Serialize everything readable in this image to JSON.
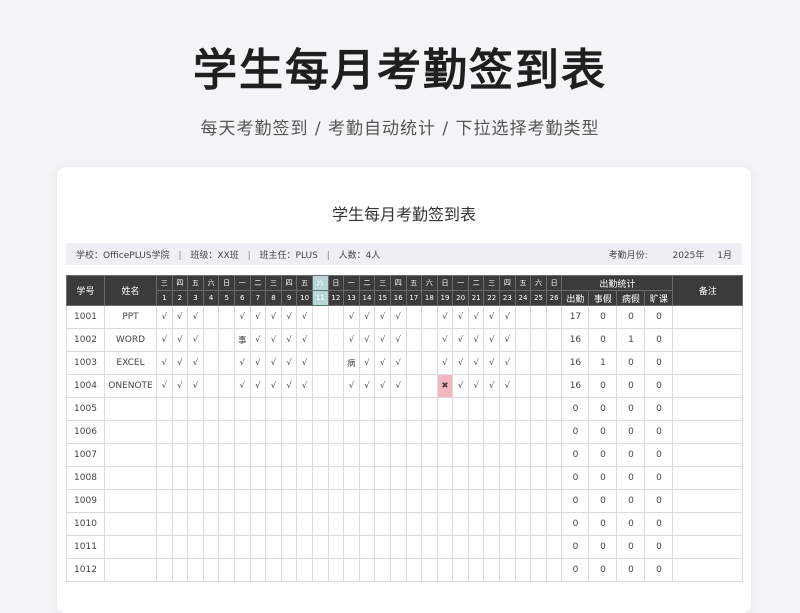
{
  "hero": {
    "title": "学生每月考勤签到表",
    "subtitle": "每天考勤签到 / 考勤自动统计 / 下拉选择考勤类型"
  },
  "sheet": {
    "title": "学生每月考勤签到表",
    "school": "学校：OfficePLUS学院",
    "class_name": "班级：XX班",
    "teacher": "班主任：PLUS",
    "count": "人数：4人",
    "month_label": "考勤月份:",
    "year": "2025年",
    "month": "1月",
    "sep": "|"
  },
  "columns": {
    "id": "学号",
    "name": "姓名",
    "stats_group": "出勤统计",
    "stats": [
      "出勤",
      "事假",
      "病假",
      "旷课"
    ],
    "remark": "备注"
  },
  "weekdays": [
    "三",
    "四",
    "五",
    "六",
    "日",
    "一",
    "二",
    "三",
    "四",
    "五",
    "六",
    "日",
    "一",
    "二",
    "三",
    "四",
    "五",
    "六",
    "日",
    "一",
    "二",
    "三",
    "四",
    "五",
    "六",
    "日"
  ],
  "days": [
    "1",
    "2",
    "3",
    "4",
    "5",
    "6",
    "7",
    "8",
    "9",
    "10",
    "11",
    "12",
    "13",
    "14",
    "15",
    "16",
    "17",
    "18",
    "19",
    "20",
    "21",
    "22",
    "23",
    "24",
    "25",
    "26"
  ],
  "highlight_day_index": 10,
  "rows": [
    {
      "id": "1001",
      "name": "PPT",
      "marks": [
        "√",
        "√",
        "√",
        "",
        "",
        "√",
        "√",
        "√",
        "√",
        "√",
        "",
        "",
        "√",
        "√",
        "√",
        "√",
        "",
        "",
        "√",
        "√",
        "√",
        "√",
        "√",
        "",
        "",
        ""
      ],
      "stats": [
        "17",
        "0",
        "0",
        "0"
      ],
      "remark": ""
    },
    {
      "id": "1002",
      "name": "WORD",
      "marks": [
        "√",
        "√",
        "√",
        "",
        "",
        "事",
        "√",
        "√",
        "√",
        "√",
        "",
        "",
        "√",
        "√",
        "√",
        "√",
        "",
        "",
        "√",
        "√",
        "√",
        "√",
        "√",
        "",
        "",
        ""
      ],
      "stats": [
        "16",
        "0",
        "1",
        "0"
      ],
      "remark": ""
    },
    {
      "id": "1003",
      "name": "EXCEL",
      "marks": [
        "√",
        "√",
        "√",
        "",
        "",
        "√",
        "√",
        "√",
        "√",
        "√",
        "",
        "",
        "病",
        "√",
        "√",
        "√",
        "",
        "",
        "√",
        "√",
        "√",
        "√",
        "√",
        "",
        "",
        ""
      ],
      "stats": [
        "16",
        "1",
        "0",
        "0"
      ],
      "remark": ""
    },
    {
      "id": "1004",
      "name": "ONENOTE",
      "marks": [
        "√",
        "√",
        "√",
        "",
        "",
        "√",
        "√",
        "√",
        "√",
        "√",
        "",
        "",
        "√",
        "√",
        "√",
        "√",
        "",
        "",
        "✖",
        "√",
        "√",
        "√",
        "√",
        "",
        "",
        ""
      ],
      "stats": [
        "16",
        "0",
        "0",
        "0"
      ],
      "remark": ""
    },
    {
      "id": "1005",
      "name": "",
      "marks": [],
      "stats": [
        "0",
        "0",
        "0",
        "0"
      ],
      "remark": ""
    },
    {
      "id": "1006",
      "name": "",
      "marks": [],
      "stats": [
        "0",
        "0",
        "0",
        "0"
      ],
      "remark": ""
    },
    {
      "id": "1007",
      "name": "",
      "marks": [],
      "stats": [
        "0",
        "0",
        "0",
        "0"
      ],
      "remark": ""
    },
    {
      "id": "1008",
      "name": "",
      "marks": [],
      "stats": [
        "0",
        "0",
        "0",
        "0"
      ],
      "remark": ""
    },
    {
      "id": "1009",
      "name": "",
      "marks": [],
      "stats": [
        "0",
        "0",
        "0",
        "0"
      ],
      "remark": ""
    },
    {
      "id": "1010",
      "name": "",
      "marks": [],
      "stats": [
        "0",
        "0",
        "0",
        "0"
      ],
      "remark": ""
    },
    {
      "id": "1011",
      "name": "",
      "marks": [],
      "stats": [
        "0",
        "0",
        "0",
        "0"
      ],
      "remark": ""
    },
    {
      "id": "1012",
      "name": "",
      "marks": [],
      "stats": [
        "0",
        "0",
        "0",
        "0"
      ],
      "remark": ""
    }
  ],
  "colors": {
    "header_bg": "#3b3b3b",
    "highlight_col": "#b6d9d6",
    "absent_bg": "#f3b7bf",
    "absent_fg": "#c0392b"
  }
}
